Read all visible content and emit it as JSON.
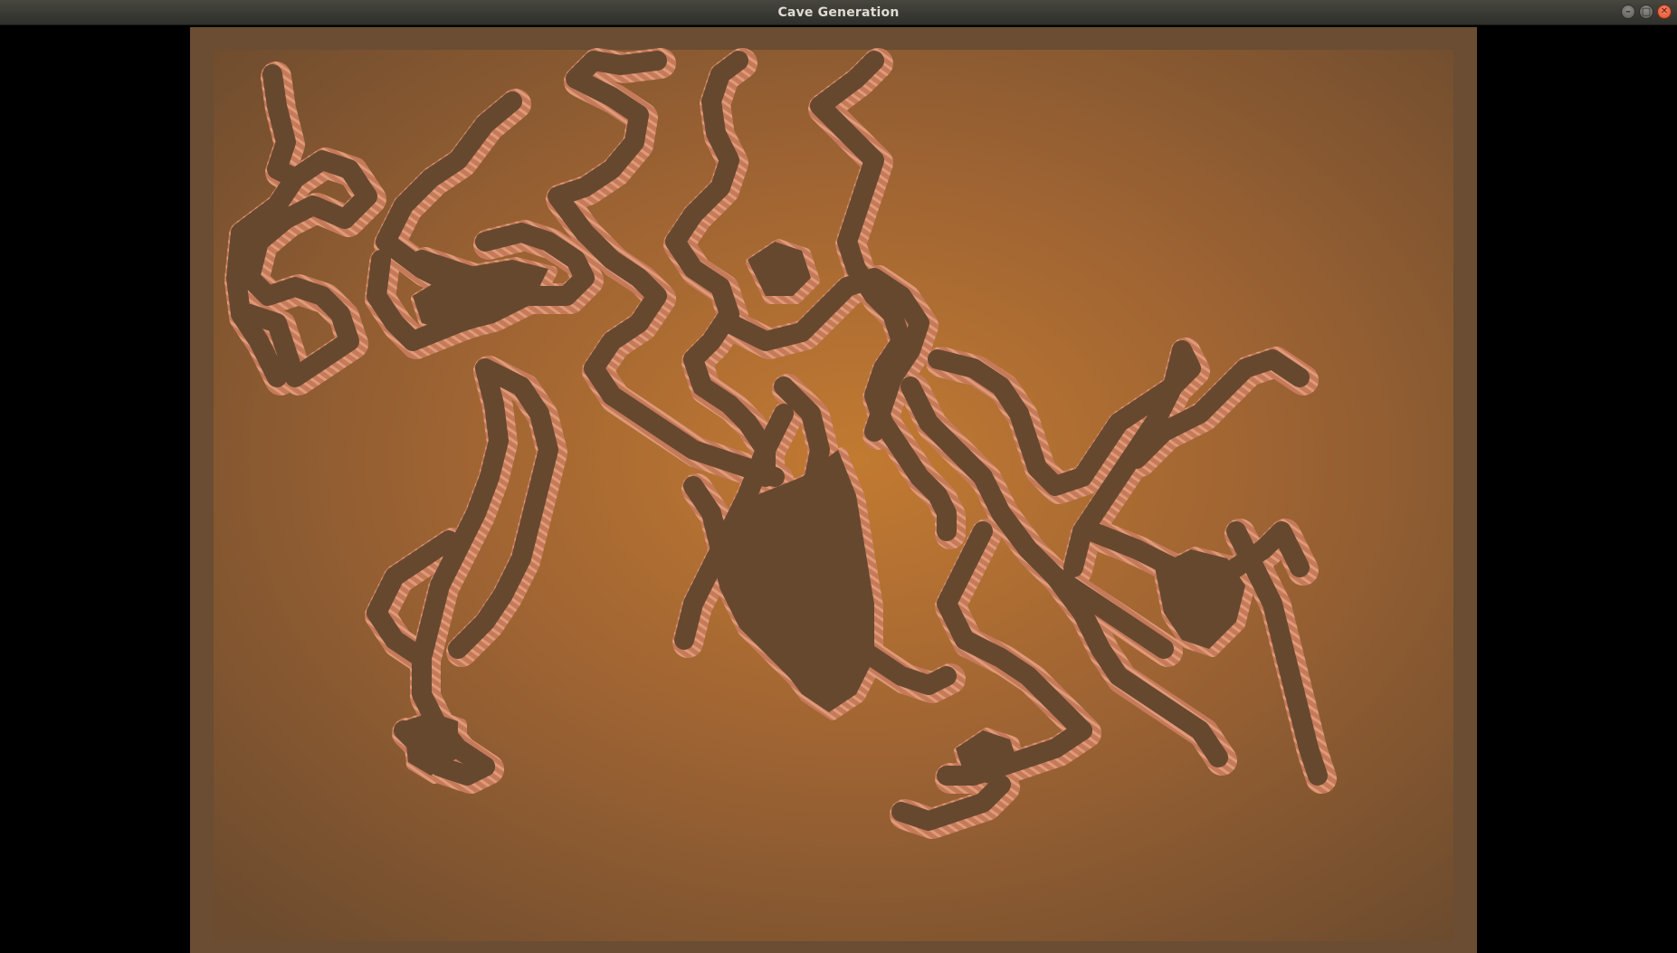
{
  "window": {
    "title": "Cave Generation",
    "controls": [
      {
        "name": "minimize",
        "glyph": "–"
      },
      {
        "name": "maximize",
        "glyph": "□"
      },
      {
        "name": "close",
        "glyph": "✕"
      }
    ]
  },
  "scene": {
    "description_colors": {
      "background_center": "#c0772f",
      "background_edge": "#6d4a2c",
      "border_frame": "#6a4d32",
      "cave_floor": "#6a4a33",
      "cave_wall_highlight": "#d08666"
    }
  }
}
